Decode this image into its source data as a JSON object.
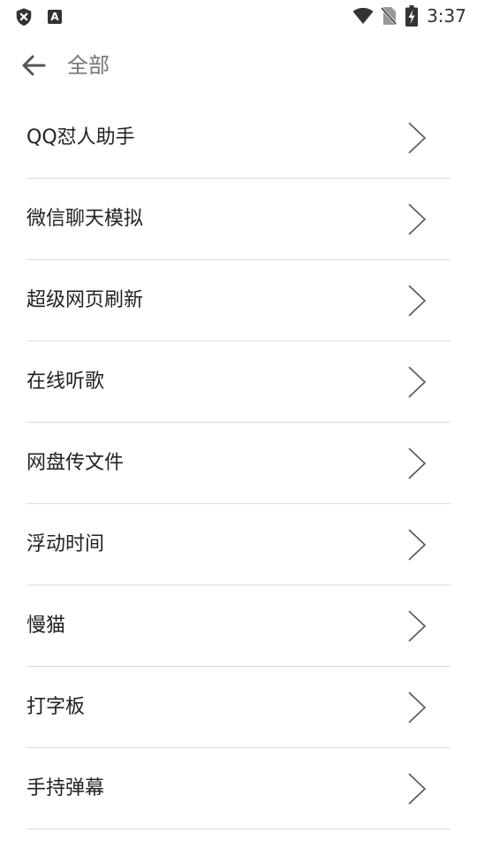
{
  "status_bar": {
    "time": "3:37",
    "notification_icon_letter": "A",
    "icons": [
      "shield-x-icon",
      "a-notification-icon",
      "wifi-icon",
      "no-sim-icon",
      "battery-charging-icon"
    ]
  },
  "toolbar": {
    "title": "全部",
    "back_icon": "arrow-left-icon"
  },
  "list": {
    "items": [
      {
        "label": "QQ怼人助手"
      },
      {
        "label": "微信聊天模拟"
      },
      {
        "label": "超级网页刷新"
      },
      {
        "label": "在线听歌"
      },
      {
        "label": "网盘传文件"
      },
      {
        "label": "浮动时间"
      },
      {
        "label": "慢猫"
      },
      {
        "label": "打字板"
      },
      {
        "label": "手持弹幕"
      }
    ],
    "item_icon": "chevron-right-icon"
  },
  "colors": {
    "title": "#777777",
    "text": "#222222",
    "divider": "#dcdcdc",
    "chevron": "#555555"
  }
}
